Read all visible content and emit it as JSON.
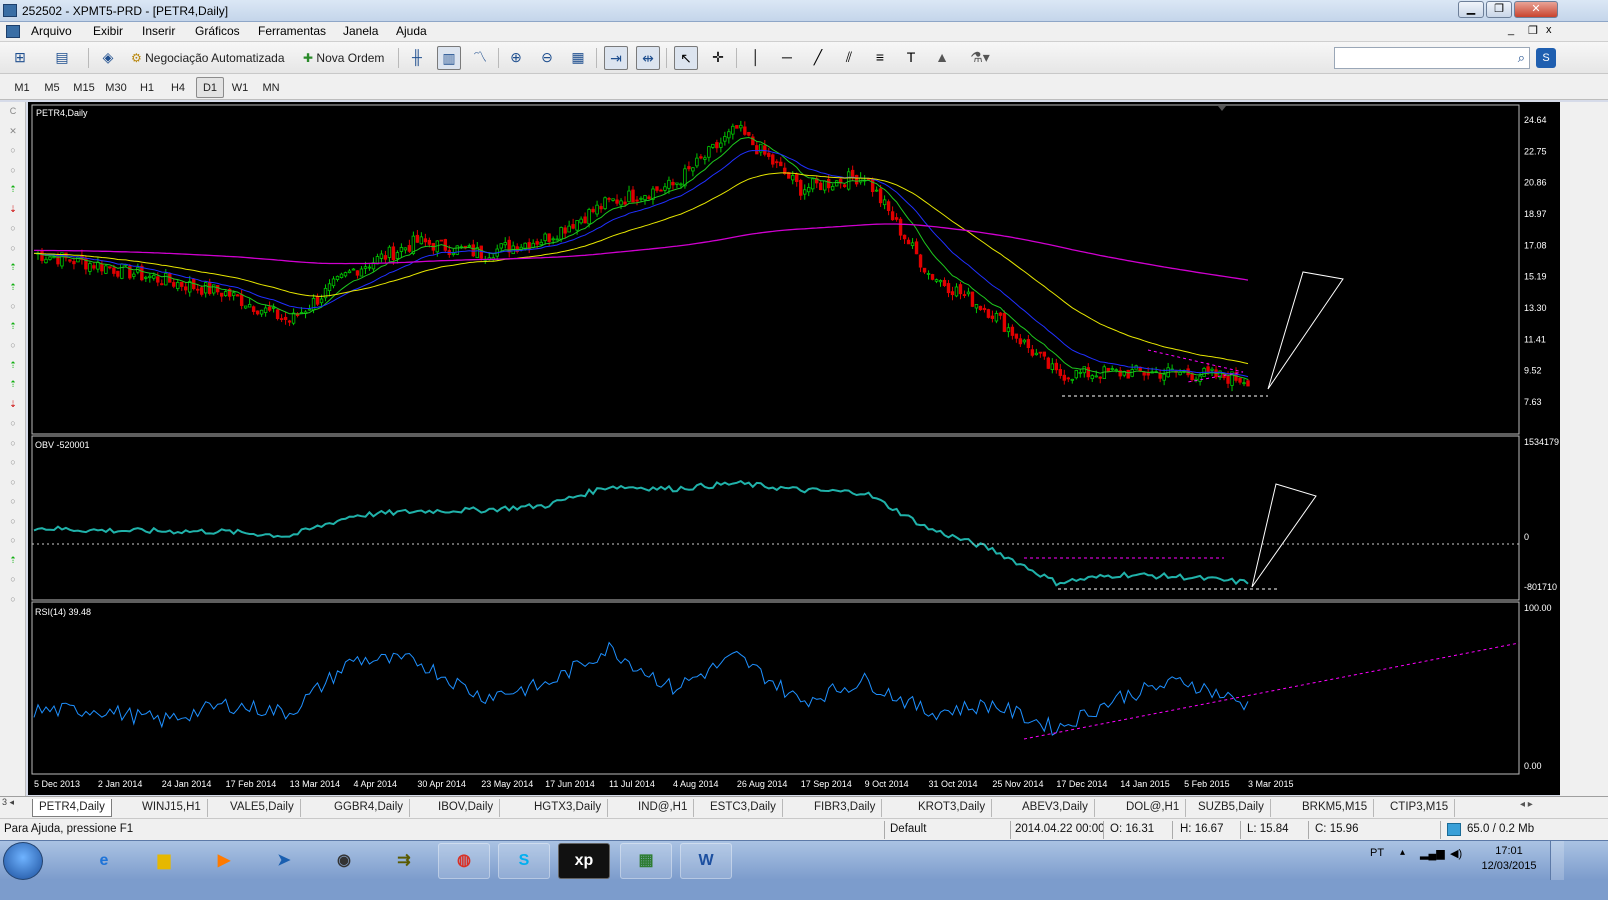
{
  "window": {
    "title": "252502 - XPMT5-PRD - [PETR4,Daily]",
    "buttons": [
      "▁",
      "❐",
      "✕"
    ],
    "mdi_buttons": [
      "_",
      "❐",
      "x"
    ]
  },
  "menu": {
    "items": [
      "Arquivo",
      "Exibir",
      "Inserir",
      "Gráficos",
      "Ferramentas",
      "Janela",
      "Ajuda"
    ]
  },
  "toolbar": {
    "algo_label": "Negociação Automatizada",
    "new_order_label": "Nova Ordem",
    "icons": [
      "new-chart-icon",
      "profiles-icon",
      "market-watch-icon",
      "bar-chart-icon",
      "candlestick-icon",
      "line-chart-icon",
      "zoom-in-icon",
      "zoom-out-icon",
      "tile-icon",
      "autoscroll-icon",
      "chart-shift-icon",
      "cursor-icon",
      "crosshair-icon",
      "vertical-line-icon",
      "horizontal-line-icon",
      "trendline-icon",
      "equidistant-channel-icon",
      "fibonacci-icon",
      "text-icon",
      "arrow-shape-icon",
      "more-tools-icon"
    ],
    "search_placeholder": ""
  },
  "timeframes": {
    "items": [
      "M1",
      "M5",
      "M15",
      "M30",
      "H1",
      "H4",
      "D1",
      "W1",
      "MN"
    ],
    "selected": "D1"
  },
  "chart": {
    "symbol_label": "PETR4,Daily",
    "obv_label": "OBV -520001",
    "rsi_label": "RSI(14) 39.48",
    "price_ticks": [
      "24.64",
      "22.75",
      "20.86",
      "18.97",
      "17.08",
      "15.19",
      "13.30",
      "11.41",
      "9.52",
      "7.63"
    ],
    "obv_ticks": [
      "1534179",
      "0",
      "-801710"
    ],
    "rsi_ticks": [
      "100.00",
      "0.00"
    ],
    "date_ticks": [
      "5 Dec 2013",
      "2 Jan 2014",
      "24 Jan 2014",
      "17 Feb 2014",
      "13 Mar 2014",
      "4 Apr 2014",
      "30 Apr 2014",
      "23 May 2014",
      "17 Jun 2014",
      "11 Jul 2014",
      "4 Aug 2014",
      "26 Aug 2014",
      "17 Sep 2014",
      "9 Oct 2014",
      "31 Oct 2014",
      "25 Nov 2014",
      "17 Dec 2014",
      "14 Jan 2015",
      "5 Feb 2015",
      "3 Mar 2015"
    ],
    "colors": {
      "bull": "#00c800",
      "bear": "#e00000",
      "ma_fast": "#1ec81e",
      "ma_mid": "#2030ff",
      "ma_slow": "#e6e600",
      "ma_long": "#d000d0",
      "obv": "#20b2aa",
      "rsi": "#1e90ff",
      "trend": "#ff00ff"
    }
  },
  "chart_data": {
    "type": "line",
    "title": "PETR4,Daily",
    "x": [
      "5 Dec 2013",
      "2 Jan 2014",
      "24 Jan 2014",
      "17 Feb 2014",
      "13 Mar 2014",
      "4 Apr 2014",
      "30 Apr 2014",
      "23 May 2014",
      "17 Jun 2014",
      "11 Jul 2014",
      "4 Aug 2014",
      "26 Aug 2014",
      "17 Sep 2014",
      "9 Oct 2014",
      "31 Oct 2014",
      "25 Nov 2014",
      "17 Dec 2014",
      "14 Jan 2015",
      "5 Feb 2015",
      "3 Mar 2015"
    ],
    "series": [
      {
        "name": "PETR4,Daily",
        "values": [
          16.6,
          15.9,
          15.0,
          14.2,
          12.5,
          15.6,
          17.3,
          16.6,
          17.5,
          19.7,
          20.7,
          24.1,
          20.5,
          21.3,
          15.4,
          13.0,
          9.3,
          9.4,
          9.4,
          9.0
        ]
      },
      {
        "name": "OBV -520001",
        "values": [
          150000,
          110000,
          100000,
          90000,
          20000,
          350000,
          420000,
          440000,
          510000,
          820000,
          780000,
          870000,
          760000,
          720000,
          140000,
          -200000,
          -730000,
          -600000,
          -640000,
          -730000
        ]
      },
      {
        "name": "RSI(14) 39.48",
        "values": [
          36,
          37,
          30,
          40,
          35,
          68,
          67,
          45,
          52,
          75,
          50,
          70,
          42,
          55,
          35,
          40,
          25,
          45,
          55,
          39.48
        ]
      }
    ],
    "ylim_price": [
      7.63,
      24.64
    ],
    "ylim_rsi": [
      0,
      100
    ],
    "legend": "none",
    "grid": false
  },
  "tabs": {
    "items": [
      "PETR4,Daily",
      "WINJ15,H1",
      "VALE5,Daily",
      "GGBR4,Daily",
      "IBOV,Daily",
      "HGTX3,Daily",
      "IND@,H1",
      "ESTC3,Daily",
      "FIBR3,Daily",
      "KROT3,Daily",
      "ABEV3,Daily",
      "DOL@,H1",
      "SUZB5,Daily",
      "BRKM5,M15",
      "CTIP3,M15"
    ],
    "selected": "PETR4,Daily"
  },
  "status": {
    "help": "Para Ajuda, pressione F1",
    "profile": "Default",
    "date": "2014.04.22 00:00",
    "open": "O: 16.31",
    "high": "H: 16.67",
    "low": "L: 15.84",
    "close": "C: 15.96",
    "traffic": "65.0 / 0.2 Mb"
  },
  "taskbar": {
    "apps": [
      "internet-explorer-icon",
      "file-explorer-icon",
      "media-player-icon",
      "network-icon",
      "hp-icon",
      "trading-app-icon",
      "chrome-icon",
      "skype-icon",
      "xp-icon",
      "metatrader-icon",
      "word-icon"
    ],
    "lang": "PT",
    "time": "17:01",
    "date": "12/03/2015"
  }
}
